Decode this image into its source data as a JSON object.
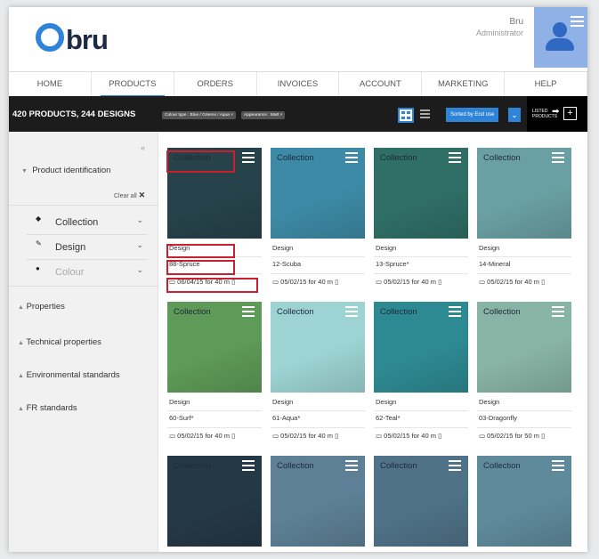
{
  "header": {
    "logo": "bru",
    "user_name": "Bru",
    "user_role": "Administrator"
  },
  "nav": [
    "HOME",
    "PRODUCTS",
    "ORDERS",
    "INVOICES",
    "ACCOUNT",
    "MARKETING",
    "HELP"
  ],
  "nav_active": "PRODUCTS",
  "toolbar": {
    "count": "420 PRODUCTS, 244 DESIGNS",
    "filter_chips": [
      "Colour type : Blue / Greens / Aqua ×",
      "Appearance : Matt ×"
    ],
    "sort_label": "Sorted by End use",
    "listed_label": "LISTED PRODUCTS"
  },
  "sidebar": {
    "collapse_icon": "«",
    "product_identification": "Product identification",
    "clear_all": "Clear all",
    "filters": [
      {
        "label": "Collection",
        "icon": "swatch-icon"
      },
      {
        "label": "Design",
        "icon": "pencil-icon"
      },
      {
        "label": "Colour",
        "icon": "droplet-icon"
      }
    ],
    "sections": [
      "Properties",
      "Technical properties",
      "Environmental standards",
      "FR standards"
    ]
  },
  "colors": {
    "accent": "#2f84d8",
    "highlight": "#c8202c",
    "toolbar_bg": "#1c1c1c"
  },
  "products": [
    {
      "collection": "Collection",
      "design_label": "Design",
      "name": "88-Spruce",
      "date": "06/04/15 for 40 m",
      "color": "#27424a"
    },
    {
      "collection": "Collection",
      "design_label": "Design",
      "name": "12-Scuba",
      "date": "05/02/15 for 40 m",
      "color": "#3d8aa6"
    },
    {
      "collection": "Collection",
      "design_label": "Design",
      "name": "13-Spruce*",
      "date": "05/02/15 for 40 m",
      "color": "#2f6f66"
    },
    {
      "collection": "Collection",
      "design_label": "Design",
      "name": "14-Mineral",
      "date": "05/02/15 for 40 m",
      "color": "#6aa0a3"
    },
    {
      "collection": "Collection",
      "design_label": "Design",
      "name": "60-Surf*",
      "date": "05/02/15 for 40 m",
      "color": "#5e9a58"
    },
    {
      "collection": "Collection",
      "design_label": "Design",
      "name": "61-Aqua*",
      "date": "05/02/15 for 40 m",
      "color": "#9dd4d3"
    },
    {
      "collection": "Collection",
      "design_label": "Design",
      "name": "62-Teal*",
      "date": "05/02/15 for 40 m",
      "color": "#2e8a92"
    },
    {
      "collection": "Collection",
      "design_label": "Design",
      "name": "03-Dragonfly",
      "date": "05/02/15 for 50 m",
      "color": "#88b4a5"
    },
    {
      "collection": "Collection",
      "design_label": "",
      "name": "",
      "date": "",
      "color": "#253846"
    },
    {
      "collection": "Collection",
      "design_label": "",
      "name": "",
      "date": "",
      "color": "#5d8096"
    },
    {
      "collection": "Collection",
      "design_label": "",
      "name": "",
      "date": "",
      "color": "#4f7288"
    },
    {
      "collection": "Collection",
      "design_label": "",
      "name": "",
      "date": "",
      "color": "#5f8a9c"
    }
  ]
}
